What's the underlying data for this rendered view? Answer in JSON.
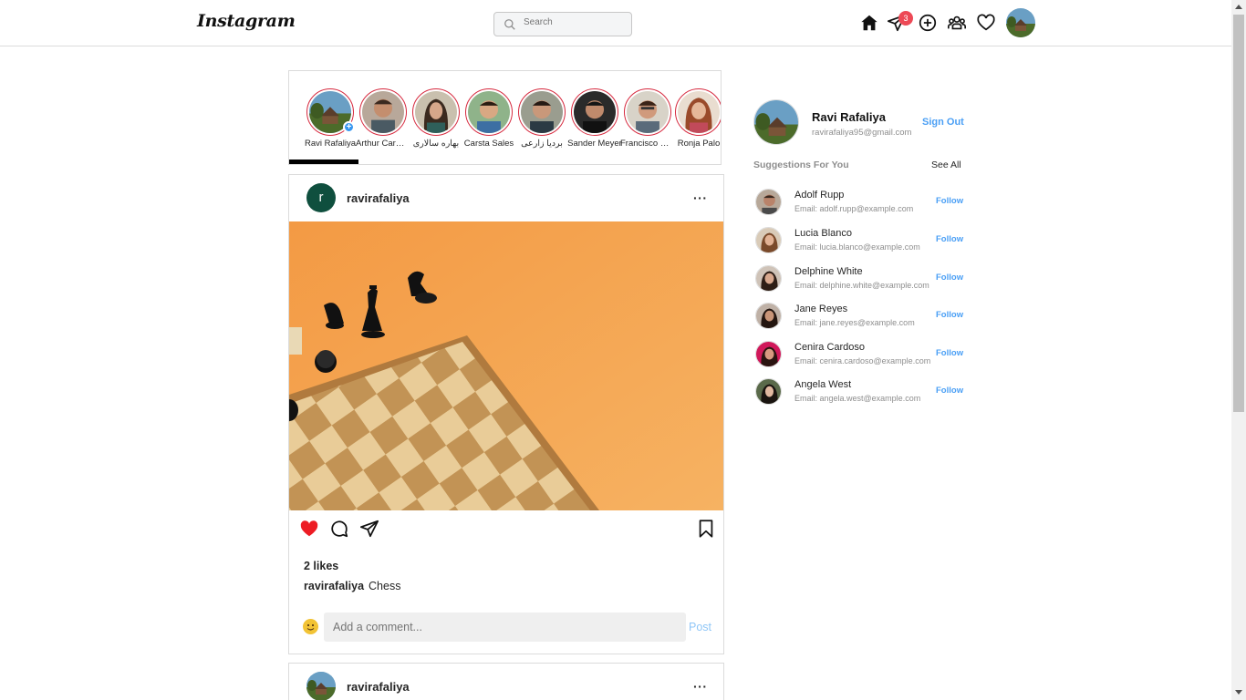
{
  "header": {
    "logo": "Instagram",
    "search_placeholder": "Search",
    "messages_badge": "3",
    "icons": [
      "home-icon",
      "direct-message-icon",
      "new-post-icon",
      "explore-people-icon",
      "activity-heart-icon"
    ]
  },
  "stories": [
    {
      "name": "Ravi Rafaliya"
    },
    {
      "name": "Arthur Carmona"
    },
    {
      "name": "بهاره سالاری"
    },
    {
      "name": "Carsta Sales"
    },
    {
      "name": "بردیا زارعی"
    },
    {
      "name": "Sander Meyer"
    },
    {
      "name": "Francisco Ramos"
    },
    {
      "name": "Ronja Palo"
    }
  ],
  "posts": [
    {
      "avatar_letter": "r",
      "username": "ravirafaliya",
      "more": "···",
      "likes": "2 likes",
      "caption_user": "ravirafaliya",
      "caption_text": "Chess",
      "comment_placeholder": "Add a comment...",
      "post_label": "Post",
      "liked": true
    },
    {
      "username": "ravirafaliya",
      "more": "···"
    }
  ],
  "sidebar": {
    "name": "Ravi Rafaliya",
    "email": "ravirafaliya95@gmail.com",
    "sign_out": "Sign Out",
    "suggestions_title": "Suggestions For You",
    "see_all": "See All",
    "suggestions": [
      {
        "name": "Adolf Rupp",
        "email": "Email: adolf.rupp@example.com",
        "follow": "Follow"
      },
      {
        "name": "Lucia Blanco",
        "email": "Email: lucia.blanco@example.com",
        "follow": "Follow"
      },
      {
        "name": "Delphine White",
        "email": "Email: delphine.white@example.com",
        "follow": "Follow"
      },
      {
        "name": "Jane Reyes",
        "email": "Email: jane.reyes@example.com",
        "follow": "Follow"
      },
      {
        "name": "Cenira Cardoso",
        "email": "Email: cenira.cardoso@example.com",
        "follow": "Follow"
      },
      {
        "name": "Angela West",
        "email": "Email: angela.west@example.com",
        "follow": "Follow"
      }
    ]
  },
  "colors": {
    "accent_blue": "#4a9ff5",
    "story_ring": "#d6293e",
    "like_red": "#ed1c24",
    "badge_red": "#ed4956"
  }
}
